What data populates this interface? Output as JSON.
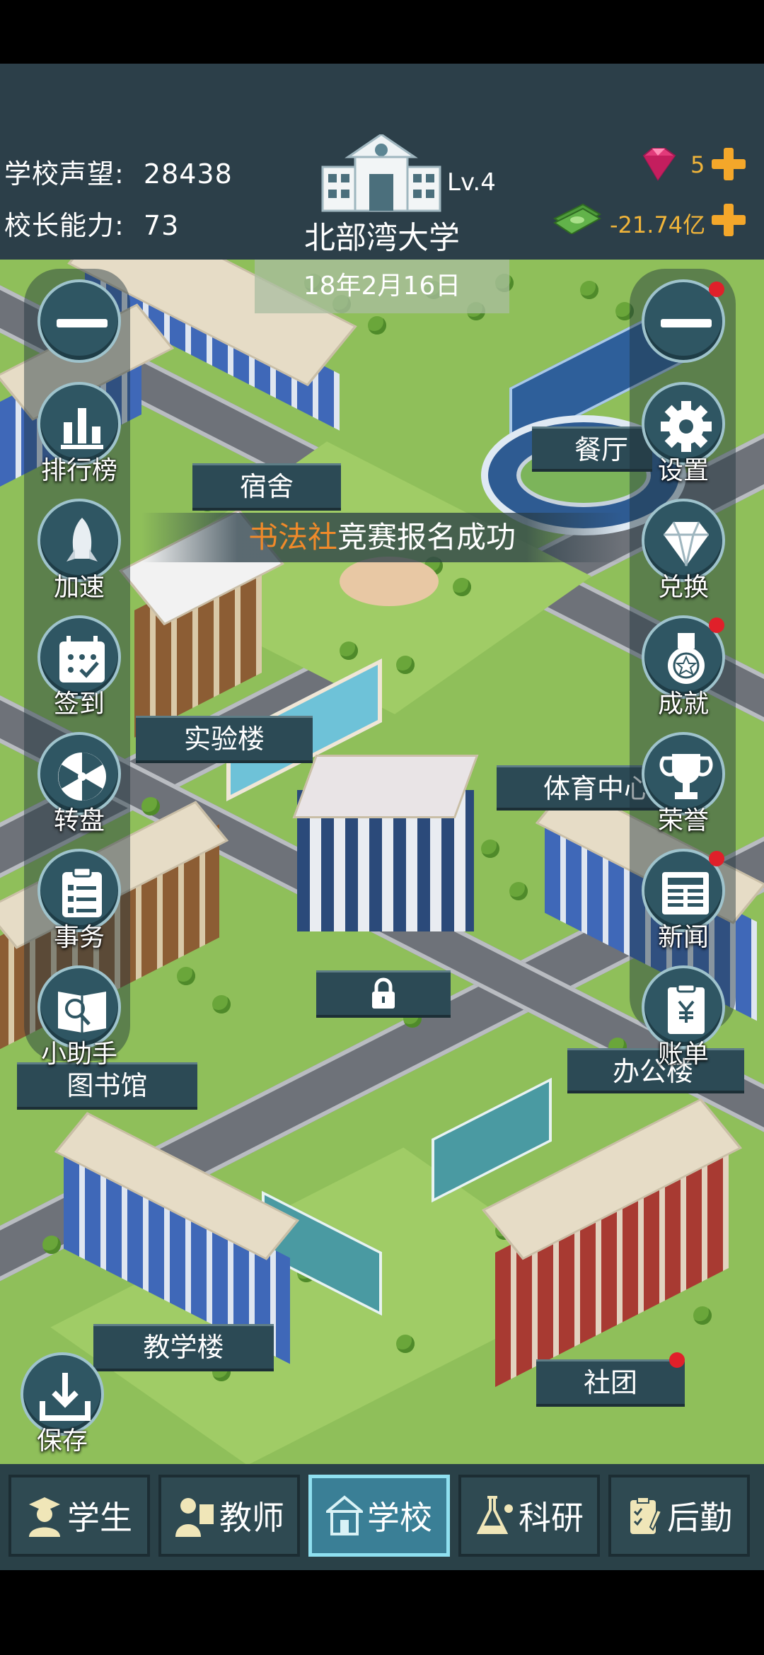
{
  "header": {
    "reputation_label": "学校声望:",
    "reputation_value": "28438",
    "ability_label": "校长能力:",
    "ability_value": "73",
    "school_name": "北部湾大学",
    "level": "Lv.4",
    "gems": "5",
    "money": "-21.74亿",
    "date": "18年2月16日"
  },
  "notice": {
    "highlight": "书法社",
    "text": "竞赛报名成功"
  },
  "left_menu": [
    {
      "label": "",
      "icon": "minus-icon"
    },
    {
      "label": "排行榜",
      "icon": "bar-chart-icon"
    },
    {
      "label": "加速",
      "icon": "rocket-icon"
    },
    {
      "label": "签到",
      "icon": "calendar-icon"
    },
    {
      "label": "转盘",
      "icon": "wheel-icon"
    },
    {
      "label": "事务",
      "icon": "clipboard-icon"
    },
    {
      "label": "小助手",
      "icon": "helper-icon"
    }
  ],
  "right_menu": [
    {
      "label": "",
      "icon": "minus-icon"
    },
    {
      "label": "设置",
      "icon": "gear-icon"
    },
    {
      "label": "兑换",
      "icon": "diamond-icon"
    },
    {
      "label": "成就",
      "icon": "medal-icon"
    },
    {
      "label": "荣誉",
      "icon": "trophy-icon"
    },
    {
      "label": "新闻",
      "icon": "newspaper-icon"
    },
    {
      "label": "账单",
      "icon": "bill-icon"
    }
  ],
  "buildings": {
    "dorm": "宿舍",
    "canteen": "餐厅",
    "lab": "实验楼",
    "stadium": "体育中心",
    "library": "图书馆",
    "office": "办公楼",
    "teaching": "教学楼",
    "club": "社团"
  },
  "save_label": "保存",
  "tabs": [
    {
      "label": "学生",
      "icon": "student-icon"
    },
    {
      "label": "教师",
      "icon": "teacher-icon"
    },
    {
      "label": "学校",
      "icon": "school-icon"
    },
    {
      "label": "科研",
      "icon": "flask-icon"
    },
    {
      "label": "后勤",
      "icon": "logistics-icon"
    }
  ],
  "colors": {
    "header_bg": "#2c3f49",
    "grass": "#8fbf5a",
    "notice_highlight": "#f08a2a",
    "active_tab": "#3a7f96",
    "badge": "#e0202a"
  }
}
